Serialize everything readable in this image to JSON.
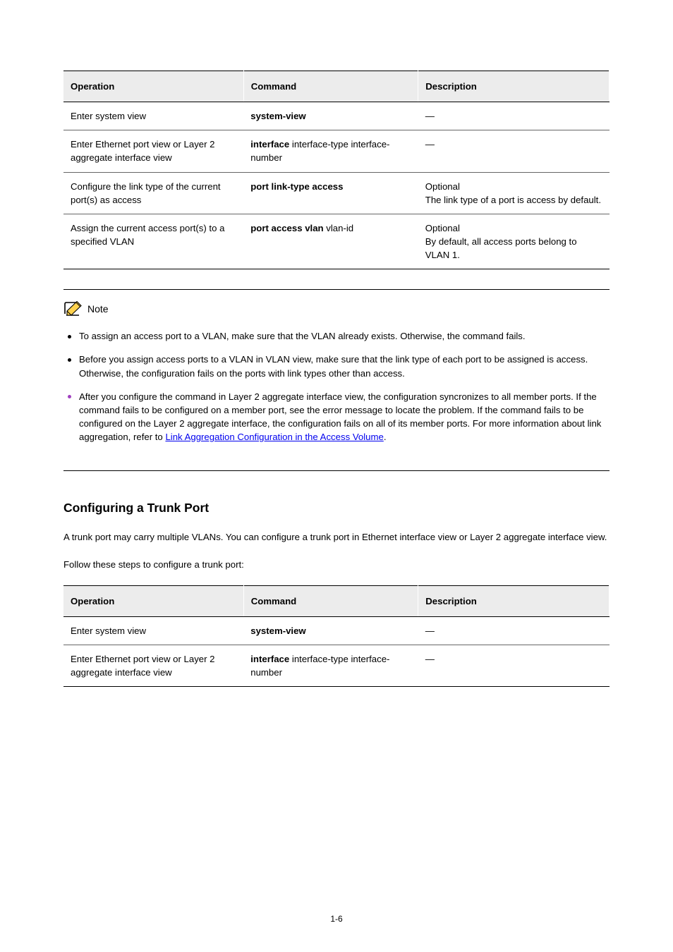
{
  "table1": {
    "headers": [
      "Operation",
      "Command",
      "Description"
    ],
    "rows": [
      {
        "op": "Enter system view",
        "cmd_plain": "system-view",
        "desc": "—"
      },
      {
        "op": "Enter Ethernet port view or Layer 2 aggregate interface view",
        "cmd_prefix": "interface",
        "cmd_args": " interface-type interface-number",
        "desc": "—"
      },
      {
        "op": "Configure the link type of the current port(s) as access",
        "cmd_plain": "port link-type access",
        "desc": "Optional\nThe link type of a port is access by default."
      },
      {
        "op": "Assign the current access port(s) to a specified VLAN",
        "cmd_prefix": "port access vlan",
        "cmd_args": " vlan-id",
        "desc": "Optional\nBy default, all access ports belong to VLAN 1."
      }
    ]
  },
  "note": {
    "label": "Note",
    "items": [
      "To assign an access port to a VLAN, make sure that the VLAN already exists. Otherwise, the command fails.",
      "Before you assign access ports to a VLAN in VLAN view, make sure that the link type of each port to be assigned is access. Otherwise, the configuration fails on the ports with link types other than access.",
      {
        "lead": "After you configure the command in Layer 2 aggregate interface view, the configuration syncronizes to all member ports. If the command fails to be configured on a member port, see the error message to locate the problem. If the command fails to be configured on the Layer 2 aggregate interface, the configuration fails on all of its member ports. For more information about link aggregation, refer to ",
        "link": "Link Aggregation Configuration in the Access Volume",
        "tail": "."
      }
    ]
  },
  "section": {
    "title": "Configuring a Trunk Port",
    "para": "A trunk port may carry multiple VLANs. You can configure a trunk port in Ethernet interface view or Layer 2 aggregate interface view.",
    "subpara": "Follow these steps to configure a trunk port:"
  },
  "table2": {
    "headers": [
      "Operation",
      "Command",
      "Description"
    ],
    "rows": [
      {
        "op": "Enter system view",
        "cmd_plain": "system-view",
        "desc": "—"
      },
      {
        "op": "Enter Ethernet port view or Layer 2 aggregate interface view",
        "cmd_prefix": "interface",
        "cmd_args": " interface-type interface-number",
        "desc": "—"
      }
    ]
  },
  "page_number": "1-6"
}
